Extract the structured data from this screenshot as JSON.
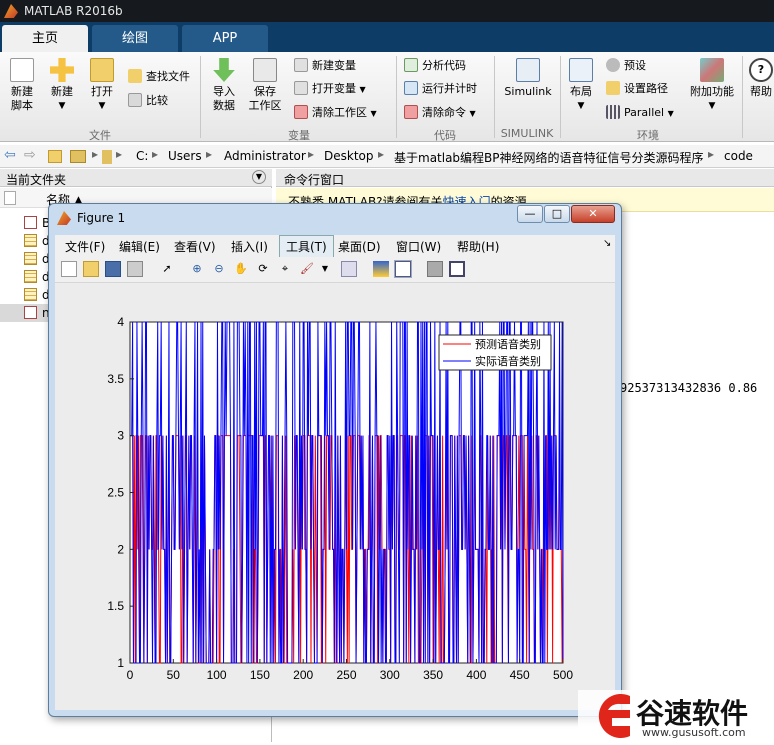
{
  "window": {
    "title": "MATLAB R2016b"
  },
  "tabs": [
    {
      "label": "主页",
      "active": true
    },
    {
      "label": "绘图",
      "active": false
    },
    {
      "label": "APP",
      "active": false
    }
  ],
  "ribbon": {
    "file": {
      "new_script": "新建\n脚本",
      "new": "新建",
      "open": "打开",
      "find_files": "查找文件",
      "compare": "比较",
      "group": "文件"
    },
    "variable": {
      "import": "导入\n数据",
      "save_ws": "保存\n工作区",
      "new_var": "新建变量",
      "open_var": "打开变量",
      "clear_ws": "清除工作区",
      "group": "变量"
    },
    "code": {
      "analyze": "分析代码",
      "run_time": "运行并计时",
      "clear_cmd": "清除命令",
      "group": "代码"
    },
    "simulink": {
      "label": "Simulink",
      "group": "SIMULINK"
    },
    "env": {
      "layout": "布局",
      "prefs": "预设",
      "set_path": "设置路径",
      "parallel": "Parallel",
      "group": "环境"
    },
    "addons": "附加功能",
    "help": "帮助"
  },
  "path": [
    "C:",
    "Users",
    "Administrator",
    "Desktop",
    "基于matlab编程BP神经网络的语音特征信号分类源码程序",
    "code"
  ],
  "left_pane": {
    "title": "当前文件夹",
    "col_name": "名称 ▲",
    "files": [
      "B",
      "d",
      "d",
      "d",
      "d",
      "n"
    ]
  },
  "command_window": {
    "title": "命令行窗口",
    "notice_text": "不熟悉 MATLAB?请参阅有关",
    "notice_link": "快速入门",
    "notice_tail": "的资源。",
    "output": "92537313432836   0.86"
  },
  "figure": {
    "title": "Figure 1",
    "menu": [
      "文件(F)",
      "编辑(E)",
      "查看(V)",
      "插入(I)",
      "工具(T)",
      "桌面(D)",
      "窗口(W)",
      "帮助(H)"
    ],
    "win_buttons": {
      "min": "—",
      "max": "□",
      "close": "✕"
    }
  },
  "chart_data": {
    "type": "line",
    "title": "",
    "xlabel": "",
    "ylabel": "",
    "xlim": [
      0,
      500
    ],
    "ylim": [
      1,
      4
    ],
    "xticks": [
      0,
      50,
      100,
      150,
      200,
      250,
      300,
      350,
      400,
      450,
      500
    ],
    "yticks": [
      1,
      1.5,
      2,
      2.5,
      3,
      3.5,
      4
    ],
    "legend_position": "top-right",
    "series": [
      {
        "name": "预测语音类别",
        "color": "#ff0000",
        "style": "step",
        "note": "values alternate among classes 1–3 over 500 samples",
        "values_range": [
          1,
          3
        ]
      },
      {
        "name": "实际语音类别",
        "color": "#0000ff",
        "style": "step",
        "note": "values alternate among classes 1–4 over 500 samples",
        "values_range": [
          1,
          4
        ]
      }
    ]
  },
  "watermark": {
    "brand": "谷速软件",
    "url": "www.gususoft.com"
  }
}
